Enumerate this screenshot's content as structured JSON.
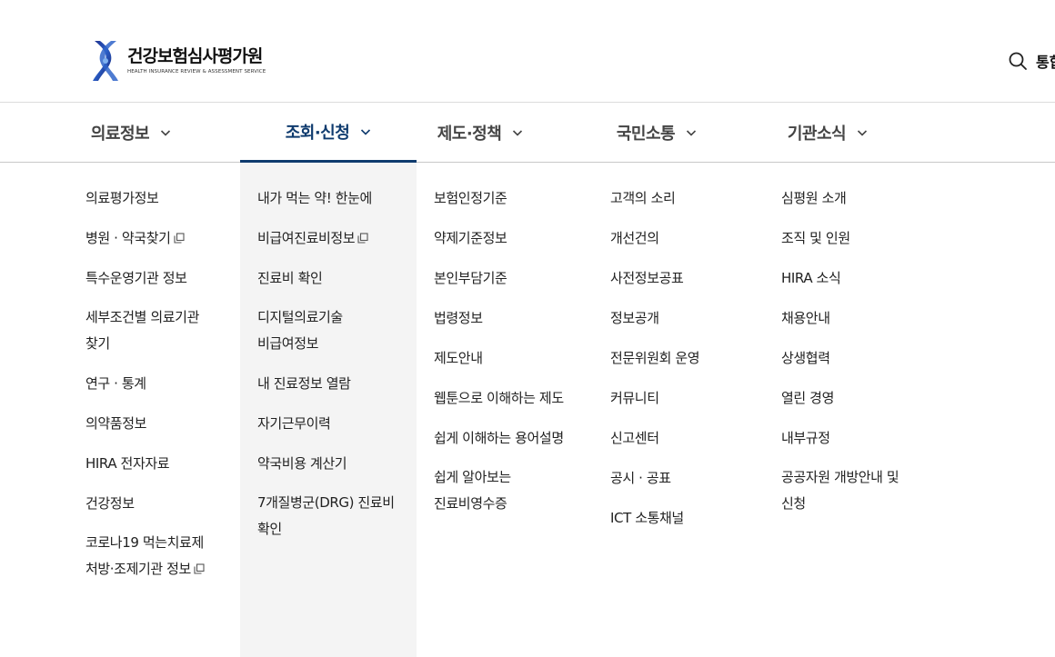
{
  "header": {
    "logo_ko": "건강보험심사평가원",
    "logo_en": "HEALTH INSURANCE REVIEW & ASSESSMENT SERVICE",
    "search_label": "통합"
  },
  "gnb": {
    "items": [
      {
        "label": "의료정보",
        "active": false
      },
      {
        "label": "조회·신청",
        "active": true
      },
      {
        "label": "제도·정책",
        "active": false
      },
      {
        "label": "국민소통",
        "active": false
      },
      {
        "label": "기관소식",
        "active": false
      }
    ]
  },
  "menu": {
    "col1": [
      {
        "label": "의료평가정보"
      },
      {
        "label": "병원 · 약국찾기",
        "external": true
      },
      {
        "label": "특수운영기관 정보"
      },
      {
        "label_l1": "세부조건별 의료기관",
        "label_l2": "찾기"
      },
      {
        "label": "연구 · 통계"
      },
      {
        "label": "의약품정보"
      },
      {
        "label": "HIRA 전자자료"
      },
      {
        "label": "건강정보"
      },
      {
        "label_l1": "코로나19 먹는치료제",
        "label_l2": "처방·조제기관 정보",
        "external": true
      }
    ],
    "col2": [
      {
        "label": "내가 먹는 약! 한눈에"
      },
      {
        "label": "비급여진료비정보",
        "external": true
      },
      {
        "label": "진료비 확인"
      },
      {
        "label_l1": "디지털의료기술",
        "label_l2": "비급여정보"
      },
      {
        "label": "내 진료정보 열람"
      },
      {
        "label": "자기근무이력"
      },
      {
        "label": "약국비용 계산기"
      },
      {
        "label_l1": "7개질병군(DRG) 진료비",
        "label_l2": "확인"
      }
    ],
    "col3": [
      {
        "label": "보험인정기준"
      },
      {
        "label": "약제기준정보"
      },
      {
        "label": "본인부담기준"
      },
      {
        "label": "법령정보"
      },
      {
        "label": "제도안내"
      },
      {
        "label": "웹툰으로 이해하는 제도"
      },
      {
        "label": "쉽게 이해하는 용어설명"
      },
      {
        "label_l1": "쉽게 알아보는",
        "label_l2": "진료비영수증"
      }
    ],
    "col4": [
      {
        "label": "고객의 소리"
      },
      {
        "label": "개선건의"
      },
      {
        "label": "사전정보공표"
      },
      {
        "label": "정보공개"
      },
      {
        "label": "전문위원회 운영"
      },
      {
        "label": "커뮤니티"
      },
      {
        "label": "신고센터"
      },
      {
        "label": "공시 · 공표"
      },
      {
        "label": "ICT 소통채널"
      }
    ],
    "col5": [
      {
        "label": "심평원 소개"
      },
      {
        "label": "조직 및 인원"
      },
      {
        "label": "HIRA 소식"
      },
      {
        "label": "채용안내"
      },
      {
        "label": "상생협력"
      },
      {
        "label": "열린 경영"
      },
      {
        "label": "내부규정"
      },
      {
        "label_l1": "공공자원 개방안내 및",
        "label_l2": "신청"
      }
    ]
  },
  "colors": {
    "accent": "#0f3b6e",
    "active_col_bg": "#f4f4f4"
  }
}
